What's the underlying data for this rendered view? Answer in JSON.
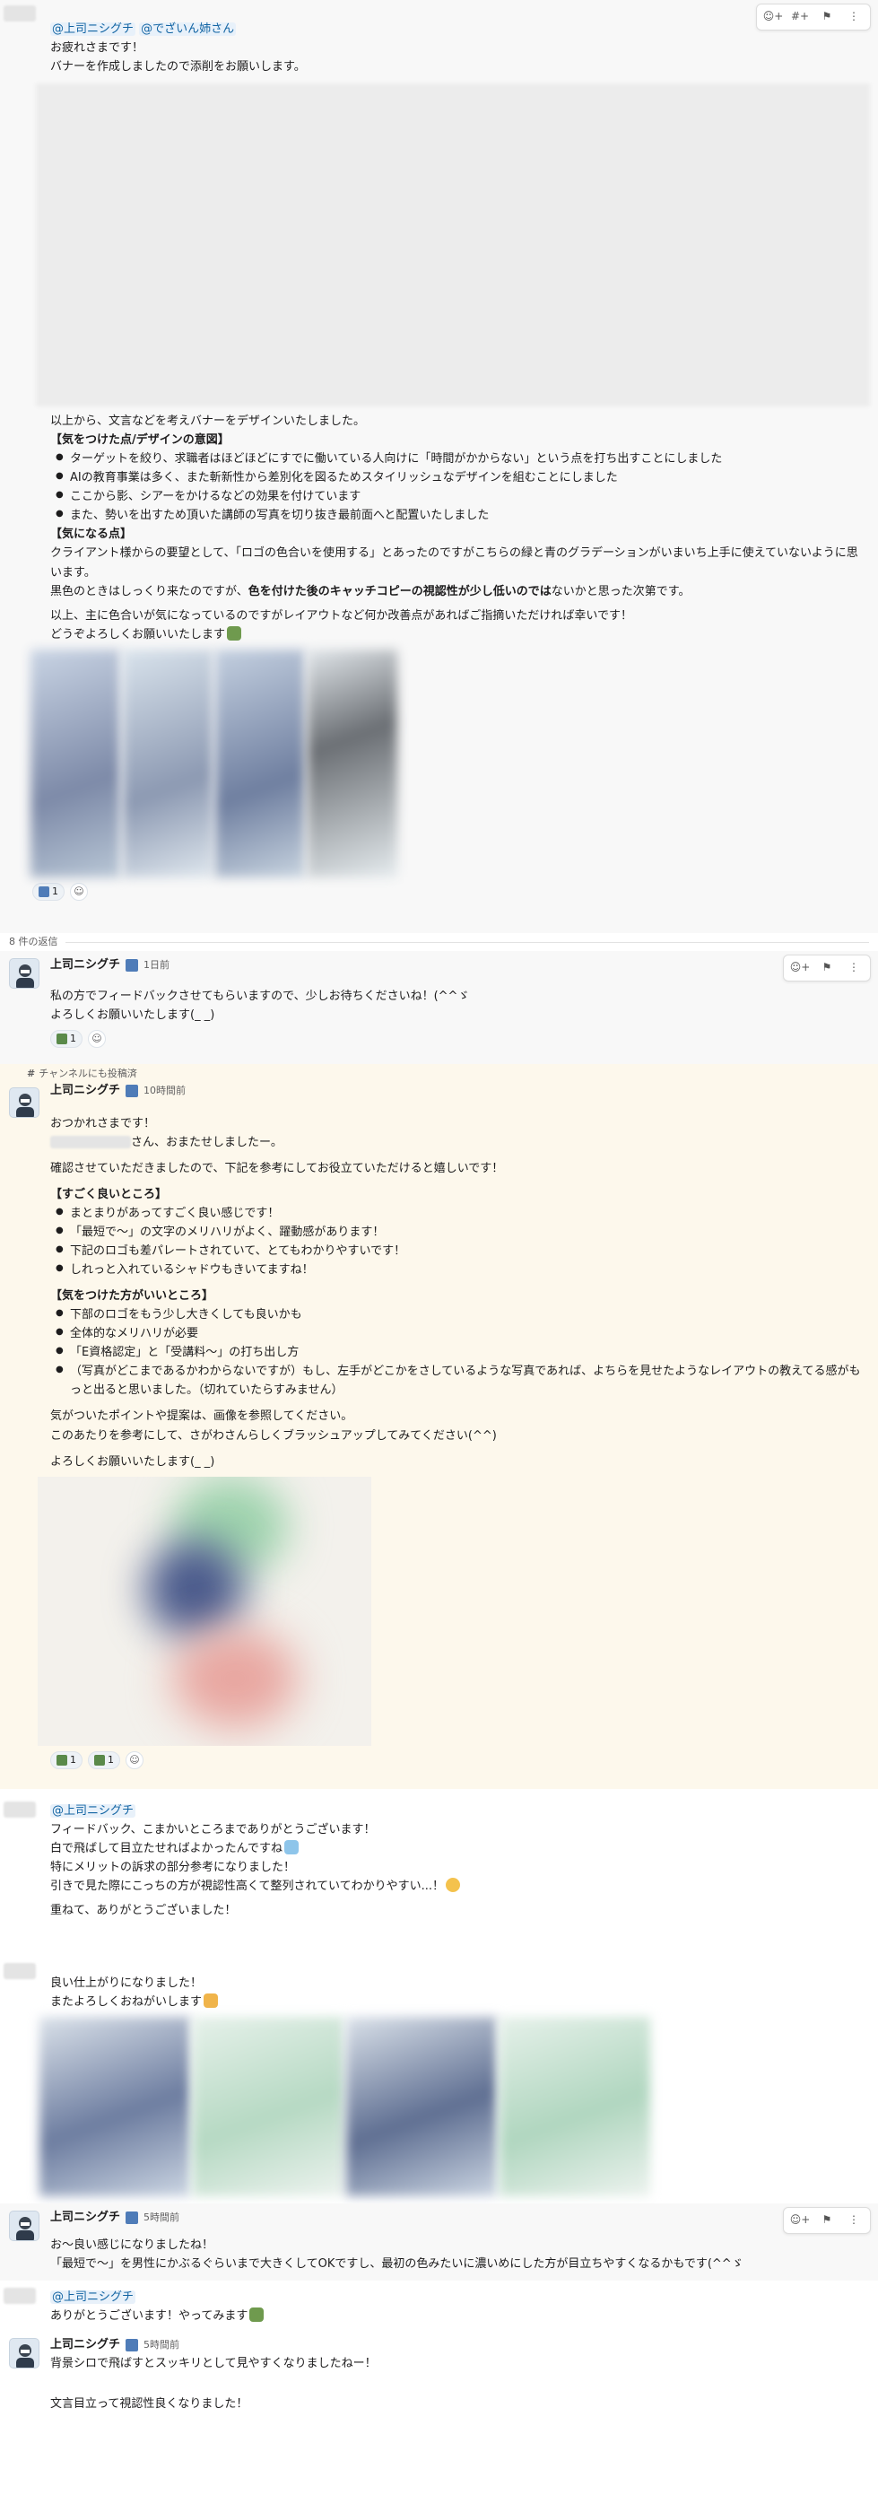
{
  "toolbar_icons": [
    "add-reaction-icon",
    "hashtag-plus-icon",
    "bookmark-icon",
    "more-icon"
  ],
  "root": {
    "mentions": [
      "@上司ニシグチ",
      "@でざいん姉さん"
    ],
    "intro": [
      "お疲れさまです！",
      "バナーを作成しましたので添削をお願いします。"
    ],
    "after_draft": "以上から、文言などを考えバナーをデザインいたしました。",
    "design_heading": "【気をつけた点/デザインの意図】",
    "design_points": [
      "ターゲットを絞り、求職者はほどほどにすでに働いている人向けに「時間がかからない」という点を打ち出すことにしました",
      "AIの教育事業は多く、また斬新性から差別化を図るためスタイリッシュなデザインを組むことにしました",
      "ここから影、シアーをかけるなどの効果を付けています",
      "また、勢いを出すため頂いた講師の写真を切り抜き最前面へと配置いたしました"
    ],
    "concern_heading": "【気になる点】",
    "concern_text": "クライアント様からの要望として、「ロゴの色合いを使用する」とあったのですがこちらの緑と青のグラデーションがいまいち上手に使えていないように思います。",
    "black_prefix": "黒色のときはしっくり来たのですが、",
    "black_bold": "色を付けた後のキャッチコピーの視認性が少し低いのでは",
    "black_suffix": "ないかと思った次第です。",
    "closing": "以上、主に色合いが気になっているのですがレイアウトなど何か改善点があればご指摘いただければ幸いです！",
    "thanks": "どうぞよろしくお願いいたします",
    "reactions": [
      {
        "count": "1"
      }
    ]
  },
  "replies_label": "8 件の返信",
  "reply1": {
    "name": "上司ニシグチ",
    "time": "1日前",
    "lines": [
      "私の方でフィードバックさせてもらいますので、少しお待ちくださいね！(^^ゞ",
      "よろしくお願いいたします(_ _)"
    ],
    "reactions": [
      {
        "count": "1"
      }
    ]
  },
  "also_posted": "チャンネルにも投稿済",
  "reply2": {
    "name": "上司ニシグチ",
    "time": "10時間前",
    "greeting": "おつかれさまです！",
    "san": "さん、おまたせしましたー。",
    "confirm": "確認させていただきましたので、下記を参考にしてお役立ていただけると嬉しいです！",
    "good_heading": "【すごく良いところ】",
    "good_points": [
      "まとまりがあってすごく良い感じです！",
      "「最短で〜」の文字のメリハリがよく、躍動感があります！",
      "下記のロゴも差パレートされていて、とてもわかりやすいです！",
      "しれっと入れているシャドウもきいてますね！"
    ],
    "care_heading": "【気をつけた方がいいところ】",
    "care_points": [
      "下部のロゴをもう少し大きくしても良いかも",
      "全体的なメリハリが必要",
      "「E資格認定」と「受講料〜」の打ち出し方",
      "（写真がどこまであるかわからないですが）もし、左手がどこかをさしているような写真であれば、よちらを見せたようなレイアウトの教えてる感がもっと出ると思いました。（切れていたらすみません）"
    ],
    "notice": "気がついたポイントや提案は、画像を参照してください。",
    "brushup": "このあたりを参考にして、さがわさんらしくブラッシュアップしてみてください(^^)",
    "regards": "よろしくお願いいたします(_ _)",
    "reactions": [
      {
        "count": "1"
      },
      {
        "count": "1"
      }
    ]
  },
  "reply3": {
    "mention": "@上司ニシグチ",
    "lines": [
      "フィードバック、こまかいところまでありがとうございます！",
      "白で飛ばして目立たせればよかったんですね"
    ],
    "meritt": "特にメリットの訴求の部分参考になりました！",
    "second": "引きで見た際にこっちの方が視認性高くて整列されていてわかりやすい...！",
    "again": "重ねて、ありがとうございました！"
  },
  "reply4": {
    "lines": [
      "良い仕上がりになりました！",
      "またよろしくおねがいします"
    ]
  },
  "reply5": {
    "name": "上司ニシグチ",
    "time": "5時間前",
    "lines": [
      "お〜良い感じになりましたね！",
      "「最短で〜」を男性にかぶるぐらいまで大きくしてOKですし、最初の色みたいに濃いめにした方が目立ちやすくなるかもです(^^ゞ"
    ]
  },
  "reply6": {
    "mention": "@上司ニシグチ",
    "line": "ありがとうございます！やってみます"
  },
  "reply7": {
    "name": "上司ニシグチ",
    "time": "5時間前",
    "line": "背景シロで飛ばすとスッキリとして見やすくなりましたねー！",
    "last": "文言目立って視認性良くなりました！"
  }
}
